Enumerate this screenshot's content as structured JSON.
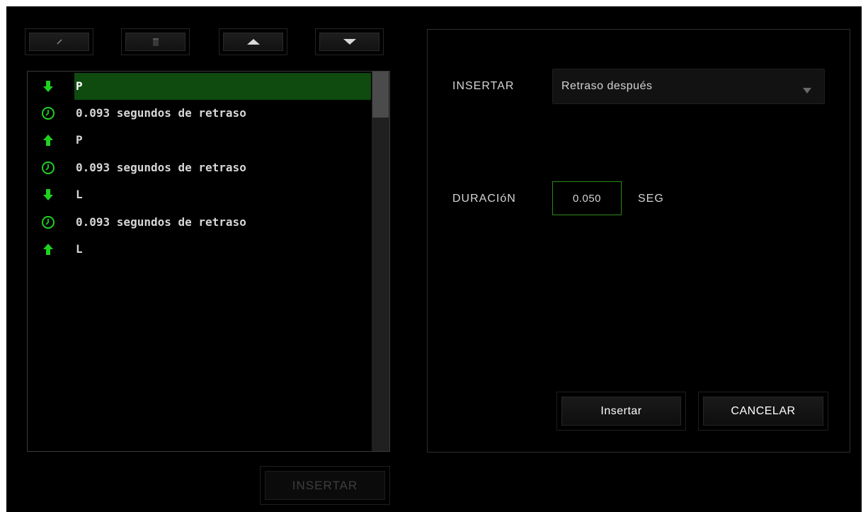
{
  "toolbar": {
    "buttons": [
      {
        "name": "edit-button",
        "icon": "pencil-icon"
      },
      {
        "name": "delete-button",
        "icon": "trash-icon"
      },
      {
        "name": "move-up-button",
        "icon": "triangle-up-icon"
      },
      {
        "name": "move-down-button",
        "icon": "triangle-down-icon"
      }
    ]
  },
  "macro_list": {
    "items": [
      {
        "type": "key-down",
        "icon": "arrow-down-icon",
        "text": "P",
        "selected": true
      },
      {
        "type": "delay",
        "icon": "clock-icon",
        "text": "0.093 segundos de retraso",
        "selected": false
      },
      {
        "type": "key-up",
        "icon": "arrow-up-icon",
        "text": "P",
        "selected": false
      },
      {
        "type": "delay",
        "icon": "clock-icon",
        "text": "0.093 segundos de retraso",
        "selected": false
      },
      {
        "type": "key-down",
        "icon": "arrow-down-icon",
        "text": "L",
        "selected": false
      },
      {
        "type": "delay",
        "icon": "clock-icon",
        "text": "0.093 segundos de retraso",
        "selected": false
      },
      {
        "type": "key-up",
        "icon": "arrow-up-icon",
        "text": "L",
        "selected": false
      }
    ]
  },
  "bottom": {
    "insert_label": "INSERTAR"
  },
  "panel": {
    "insert_label": "INSERTAR",
    "insert_select_value": "Retraso después",
    "duration_label": "DURACIóN",
    "duration_value": "0.050",
    "duration_unit": "SEG",
    "insert_button": "Insertar",
    "cancel_button": "CANCELAR"
  },
  "colors": {
    "accent_green": "#1fd11f",
    "selection_green": "#0f4a0f",
    "background": "#000000",
    "text": "#d4d4d4"
  }
}
